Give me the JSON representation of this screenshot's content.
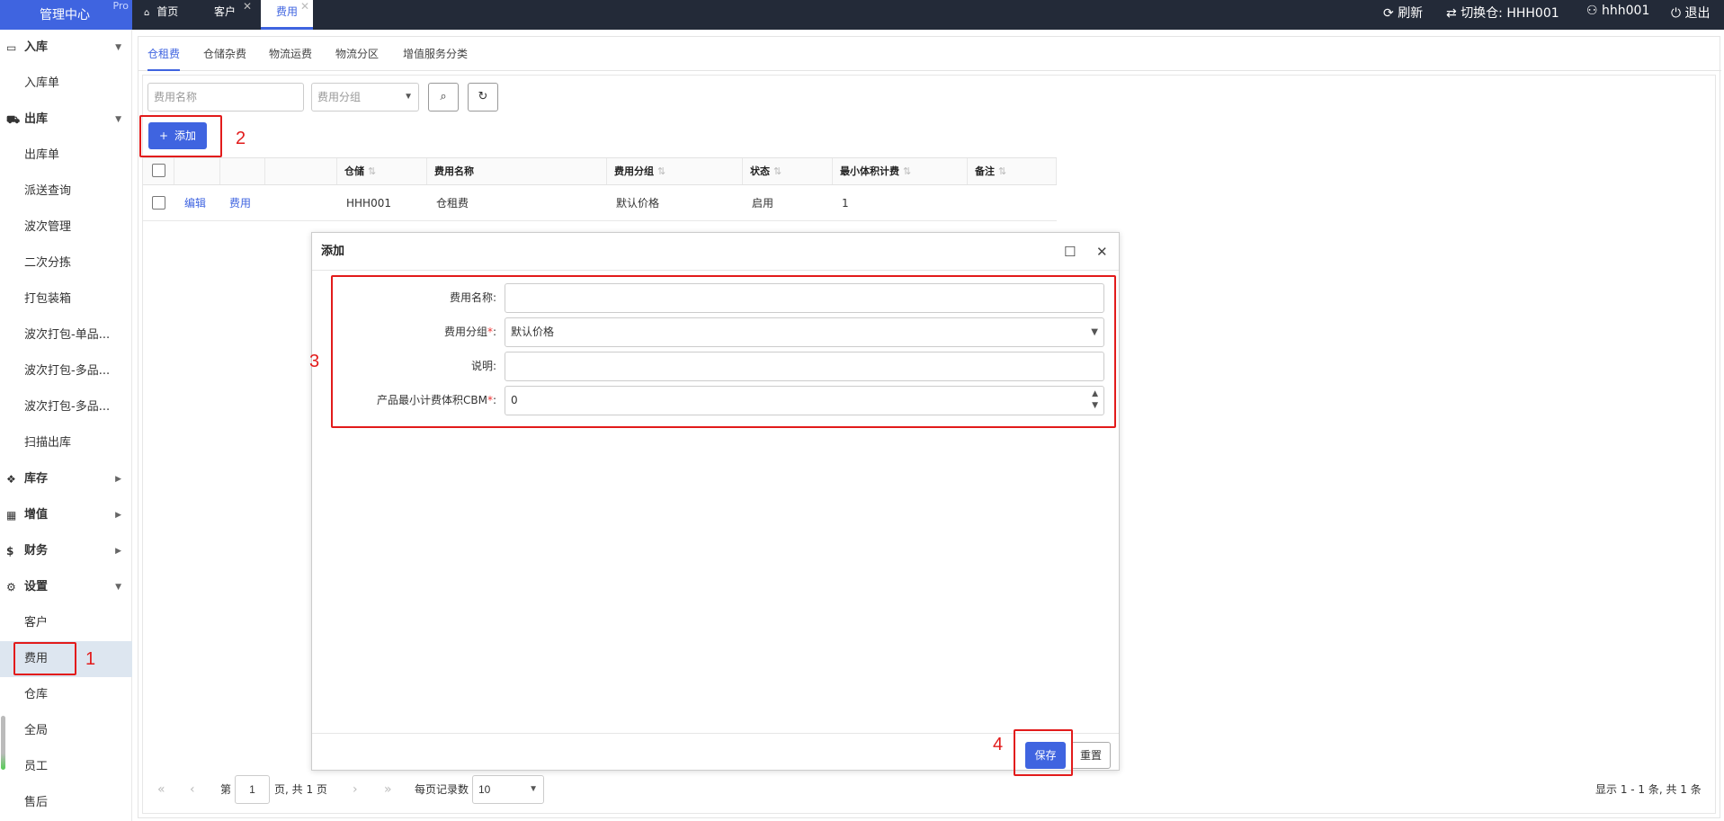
{
  "brand": {
    "title": "管理中心",
    "badge": "Pro"
  },
  "page_tabs": [
    {
      "label": "首页"
    },
    {
      "label": "客户"
    },
    {
      "label": "费用"
    }
  ],
  "topright": {
    "refresh": "刷新",
    "switch_warehouse": "切换仓: HHH001",
    "user": "hhh001",
    "logout": "退出"
  },
  "sidebar": {
    "groups": [
      {
        "label": "入库",
        "items": [
          "入库单"
        ]
      },
      {
        "label": "出库",
        "items": [
          "出库单",
          "派送查询",
          "波次管理",
          "二次分拣",
          "打包装箱",
          "波次打包-单品...",
          "波次打包-多品...",
          "波次打包-多品...",
          "扫描出库"
        ]
      },
      {
        "label": "库存"
      },
      {
        "label": "增值"
      },
      {
        "label": "财务"
      },
      {
        "label": "设置",
        "items": [
          "客户",
          "费用",
          "仓库",
          "全局",
          "员工",
          "售后"
        ]
      }
    ]
  },
  "tabs": [
    "仓租费",
    "仓储杂费",
    "物流运费",
    "物流分区",
    "增值服务分类"
  ],
  "filters": {
    "name_placeholder": "费用名称",
    "group_placeholder": "费用分组"
  },
  "add_button": "添加",
  "table": {
    "columns": [
      "仓储",
      "费用名称",
      "费用分组",
      "状态",
      "最小体积计费",
      "备注"
    ],
    "rows": [
      {
        "edit": "编辑",
        "fee": "费用",
        "warehouse": "HHH001",
        "name": "仓租费",
        "group": "默认价格",
        "status": "启用",
        "min": "1",
        "note": ""
      }
    ]
  },
  "pager": {
    "page_prefix": "第",
    "page": "1",
    "page_suffix": "页, 共 1 页",
    "per_page_label": "每页记录数",
    "per_page": "10",
    "summary": "显示 1 - 1 条, 共 1 条"
  },
  "dialog": {
    "title": "添加",
    "fields": [
      {
        "label": "费用名称:",
        "required": false,
        "value": ""
      },
      {
        "label": "费用分组",
        "required": true,
        "value": "默认价格"
      },
      {
        "label": "说明:",
        "required": false,
        "value": ""
      },
      {
        "label": "产品最小计费体积CBM",
        "required": true,
        "value": "0"
      }
    ],
    "req_mark": "*",
    "colon": ":",
    "save": "保存",
    "reset": "重置"
  },
  "annotations": [
    "1",
    "2",
    "3",
    "4"
  ],
  "colors": {
    "primary": "#3f64e0",
    "topbar": "#232a38",
    "annotation": "#e21b1b"
  }
}
